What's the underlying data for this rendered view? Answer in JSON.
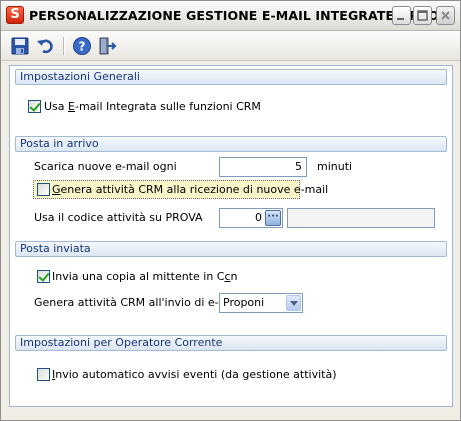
{
  "window": {
    "title": "PERSONALIZZAZIONE GESTIONE E-MAIL INTEGRATE <PRO...",
    "app_icon_glyph": "S"
  },
  "toolbar": {
    "icons": [
      "save-icon",
      "undo-icon",
      "help-icon",
      "exit-icon"
    ]
  },
  "general": {
    "header": "Impostazioni Generali",
    "use_integrated_label_pre": "Usa ",
    "use_integrated_label_mnemonic": "E",
    "use_integrated_label_post": "-mail Integrata sulle funzioni CRM",
    "use_integrated_checked": true
  },
  "incoming": {
    "header": "Posta in arrivo",
    "download_label": "Scarica nuove e-mail ogni",
    "download_value": "5",
    "download_unit": "minuti",
    "generate_label_mnemonic": "G",
    "generate_label_post": "enera attività CRM alla ricezione di nuove e-mail",
    "generate_checked": false,
    "activity_code_label": "Usa il codice attività su  PROVA",
    "activity_code_value": "0",
    "activity_code_button": "···",
    "activity_description": ""
  },
  "outgoing": {
    "header": "Posta inviata",
    "send_copy_label_pre": "Invia una copia al mittente in C",
    "send_copy_label_mnemonic": "c",
    "send_copy_label_post": "n",
    "send_copy_checked": true,
    "generate_on_send_label": "Genera attività CRM all'invio di e-mail",
    "generate_on_send_value": "Proponi"
  },
  "operator": {
    "header": "Impostazioni per Operatore Corrente",
    "auto_notify_label_mnemonic": "I",
    "auto_notify_label_post": "nvio automatico avvisi eventi (da gestione attività)",
    "auto_notify_checked": false
  },
  "colors": {
    "group_header_text": "#15357a",
    "highlight_bg": "#f8f5c8",
    "check_mark": "#21a121"
  }
}
